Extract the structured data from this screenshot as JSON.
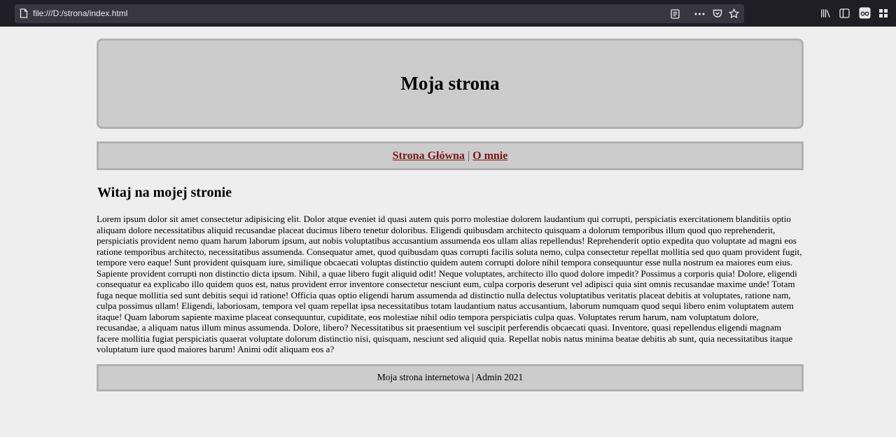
{
  "browser": {
    "url": "file:///D:/strona/index.html"
  },
  "page": {
    "header_title": "Moja strona",
    "nav": {
      "home_label": "Strona Główna",
      "separator": "|",
      "about_label": "O mnie"
    },
    "heading": "Witaj na mojej stronie",
    "paragraph": "Lorem ipsum dolor sit amet consectetur adipisicing elit. Dolor atque eveniet id quasi autem quis porro molestiae dolorem laudantium qui corrupti, perspiciatis exercitationem blanditiis optio aliquam dolore necessitatibus aliquid recusandae placeat ducimus libero tenetur doloribus. Eligendi quibusdam architecto quisquam a dolorum temporibus illum quod quo reprehenderit, perspiciatis provident nemo quam harum laborum ipsum, aut nobis voluptatibus accusantium assumenda eos ullam alias repellendus! Reprehenderit optio expedita quo voluptate ad magni eos ratione temporibus architecto, necessitatibus assumenda. Consequatur amet, quod quibusdam quas corrupti facilis soluta nemo, culpa consectetur repellat mollitia sed quo quam provident fugit, tempore vero eaque! Sunt provident quisquam iure, similique obcaecati voluptas distinctio quidem autem corrupti dolore nihil tempora consequuntur esse nulla nostrum ea maiores eum eius. Sapiente provident corrupti non distinctio dicta ipsum. Nihil, a quae libero fugit aliquid odit! Neque voluptates, architecto illo quod dolore impedit? Possimus a corporis quia! Dolore, eligendi consequatur ea explicabo illo quidem quos est, natus provident error inventore consectetur nesciunt eum, culpa corporis deserunt vel adipisci quia sint omnis recusandae maxime unde! Totam fuga neque mollitia sed sunt debitis sequi id ratione! Officia quas optio eligendi harum assumenda ad distinctio nulla delectus voluptatibus veritatis placeat debitis at voluptates, ratione nam, culpa possimus ullam! Eligendi, laboriosam, tempora vel quam repellat ipsa necessitatibus totam laudantium natus accusantium, laborum numquam quod sequi libero enim voluptatem autem itaque! Quam laborum sapiente maxime placeat consequuntur, cupiditate, eos molestiae nihil odio tempora perspiciatis culpa quas. Voluptates rerum harum, nam voluptatum dolore, recusandae, a aliquam natus illum minus assumenda. Dolore, libero? Necessitatibus sit praesentium vel suscipit perferendis obcaecati quasi. Inventore, quasi repellendus eligendi magnam facere mollitia fugiat perspiciatis quaerat voluptate dolorum distinctio nisi, quisquam, nesciunt sed aliquid quia. Repellat nobis natus minima beatae debitis ab sunt, quia necessitatibus itaque voluptatum iure quod maiores harum! Animi odit aliquam eos a?",
    "footer": "Moja strona internetowa | Admin 2021"
  },
  "colors": {
    "page_background": "#eeeeee",
    "box_background": "#cccccc",
    "box_border": "#b1b1b1",
    "link": "#7a1515",
    "chrome": "#1f1e25",
    "urlbar": "#38373f"
  },
  "icons": [
    "page-icon",
    "reader-view-icon",
    "more-actions-icon",
    "pocket-icon",
    "bookmark-star-icon",
    "library-icon",
    "sidebar-icon",
    "private-mask-icon",
    "extensions-icon"
  ]
}
